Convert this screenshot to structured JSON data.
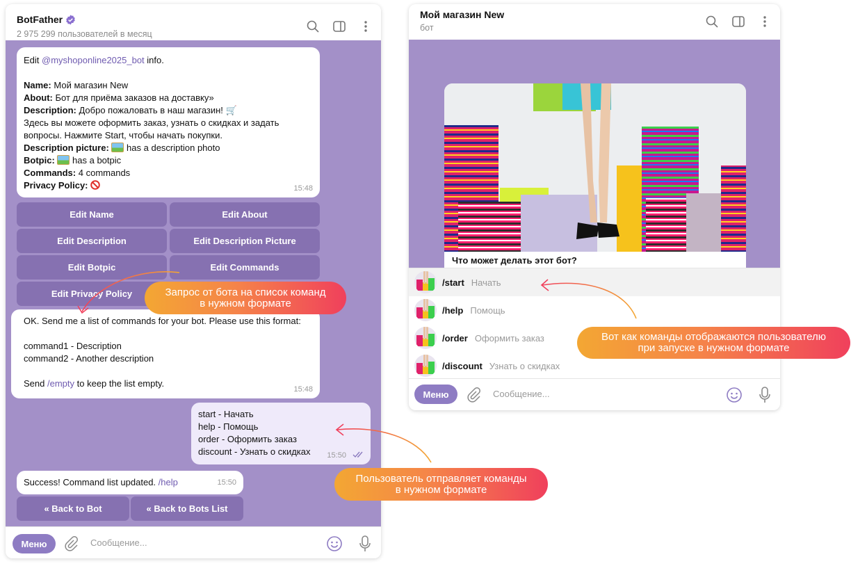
{
  "left": {
    "title": "BotFather",
    "subtitle": "2 975 299 пользователей в месяц",
    "info": {
      "edit_prefix": "Edit",
      "bot_handle": "@myshoponline2025_bot",
      "edit_suffix": "info.",
      "name_label": "Name:",
      "name_value": "Мой магазин New",
      "about_label": "About:",
      "about_value": "Бот для приёма заказов на доставку»",
      "desc_label": "Description:",
      "desc_value": "Добро пожаловать в наш магазин!",
      "desc_line2": "Здесь вы можете оформить заказ, узнать о скидках и задать",
      "desc_line3": "вопросы. Нажмите Start, чтобы начать покупки.",
      "desc_pic_label": "Description picture:",
      "desc_pic_value": "has a description photo",
      "botpic_label": "Botpic:",
      "botpic_value": "has a botpic",
      "commands_label": "Commands:",
      "commands_value": "4 commands",
      "privacy_label": "Privacy Policy:",
      "time": "15:48"
    },
    "keyboard": [
      "Edit Name",
      "Edit About",
      "Edit Description",
      "Edit Description Picture",
      "Edit Botpic",
      "Edit Commands",
      "Edit Privacy Policy"
    ],
    "ok_msg": {
      "line1": "OK. Send me a list of commands for your bot. Please use this format:",
      "line2": "command1 - Description",
      "line3": "command2 - Another description",
      "line4_prefix": "Send",
      "line4_link": "/empty",
      "line4_suffix": "to keep the list empty.",
      "time": "15:48"
    },
    "user_msg": {
      "lines": [
        "start - Начать",
        "help - Помощь",
        "order - Оформить заказ",
        "discount - Узнать о скидках"
      ],
      "time": "15:50"
    },
    "success": {
      "text": "Success! Command list updated.",
      "link": "/help",
      "time": "15:50"
    },
    "back_buttons": [
      "« Back to Bot",
      "« Back to Bots List"
    ],
    "menu_label": "Меню",
    "input_placeholder": "Сообщение..."
  },
  "right": {
    "title": "Мой магазин New",
    "subtitle": "бот",
    "card_caption": "Что может делать этот бот?",
    "commands": [
      {
        "cmd": "/start",
        "desc": "Начать"
      },
      {
        "cmd": "/help",
        "desc": "Помощь"
      },
      {
        "cmd": "/order",
        "desc": "Оформить заказ"
      },
      {
        "cmd": "/discount",
        "desc": "Узнать о скидках"
      }
    ],
    "menu_label": "Меню",
    "input_placeholder": "Сообщение..."
  },
  "callouts": {
    "request": [
      "Запрос от бота на список команд",
      "в нужном формате"
    ],
    "display": [
      "Вот как команды отображаются пользователю",
      "при запуске в нужном формате"
    ],
    "user_sends": [
      "Пользователь отправляет команды",
      "в нужном формате"
    ]
  },
  "colors": {
    "chat_bg": "#a390c8",
    "keyboard_btn": "#8671b1",
    "link": "#6f5bb0",
    "callout_gradient": [
      "#f3a733",
      "#f0405c"
    ]
  }
}
